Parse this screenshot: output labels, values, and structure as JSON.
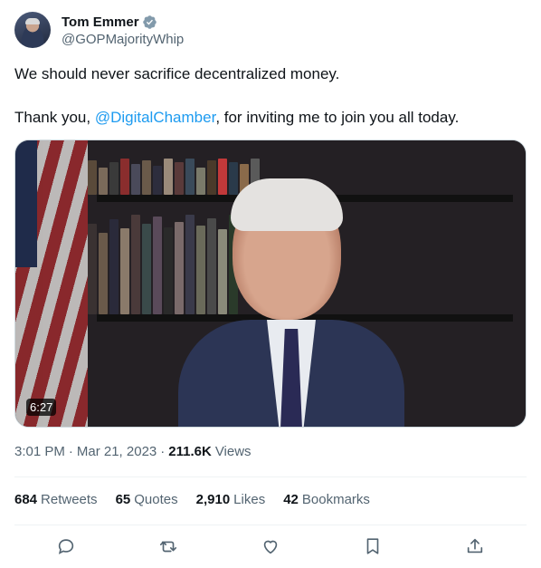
{
  "author": {
    "name": "Tom Emmer",
    "handle": "@GOPMajorityWhip",
    "verified_icon": "verified-badge-icon",
    "verified_color": "#829aab"
  },
  "tweet": {
    "line1": "We should never sacrifice decentralized money.",
    "line2_prefix": "Thank you, ",
    "mention": "@DigitalChamber",
    "line2_suffix": ", for inviting me to join you all today."
  },
  "media": {
    "duration": "6:27"
  },
  "meta": {
    "time": "3:01 PM",
    "separator": "·",
    "date": "Mar 21, 2023",
    "views_count": "211.6K",
    "views_label": "Views"
  },
  "stats": {
    "retweets_count": "684",
    "retweets_label": "Retweets",
    "quotes_count": "65",
    "quotes_label": "Quotes",
    "likes_count": "2,910",
    "likes_label": "Likes",
    "bookmarks_count": "42",
    "bookmarks_label": "Bookmarks"
  },
  "actions": [
    "reply-icon",
    "retweet-icon",
    "like-icon",
    "bookmark-icon",
    "share-icon"
  ],
  "colors": {
    "accent": "#1d9bf0",
    "text": "#0f1419",
    "muted": "#536471"
  }
}
